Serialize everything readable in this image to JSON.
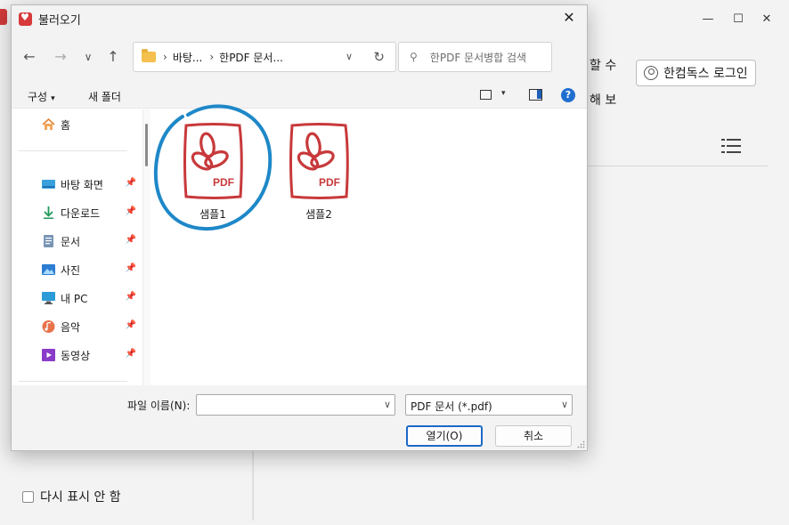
{
  "background_app": {
    "partial_text_1": "할 수",
    "partial_text_2": "해 보",
    "login_label": "한컴독스 로그인",
    "checkbox_label": "다시 표시 안 함",
    "controls": {
      "minimize": "—",
      "maximize": "☐",
      "close": "✕"
    }
  },
  "dialog": {
    "title": "불러오기",
    "close": "✕",
    "nav": {
      "back": "←",
      "forward": "→",
      "history": "∨",
      "up": "↑"
    },
    "address": {
      "sep": "›",
      "crumbs": [
        "바탕...",
        "한PDF 문서..."
      ],
      "dropdown": "∨",
      "refresh": "↻"
    },
    "search": {
      "icon": "⚲",
      "placeholder": "한PDF 문서병합 검색"
    },
    "toolbar": {
      "organize": "구성",
      "new_folder": "새 폴더",
      "caret": "▾",
      "help": "?"
    },
    "sidebar": {
      "home": "홈",
      "pin": "📌",
      "items": [
        {
          "label": "바탕 화면"
        },
        {
          "label": "다운로드"
        },
        {
          "label": "문서"
        },
        {
          "label": "사진"
        },
        {
          "label": "내 PC"
        },
        {
          "label": "음악"
        },
        {
          "label": "동영상"
        }
      ]
    },
    "files": [
      {
        "name": "샘플1",
        "badge": "PDF"
      },
      {
        "name": "샘플2",
        "badge": "PDF"
      }
    ],
    "bottom": {
      "filename_label": "파일 이름(N):",
      "filename_value": "",
      "filetype": "PDF 문서 (*.pdf)",
      "dropdown": "∨",
      "open": "열기(O)",
      "cancel": "취소"
    }
  },
  "colors": {
    "accent": "#1d68c9",
    "pdf_red": "#c8393b",
    "annotation_blue": "#1e88c8"
  }
}
